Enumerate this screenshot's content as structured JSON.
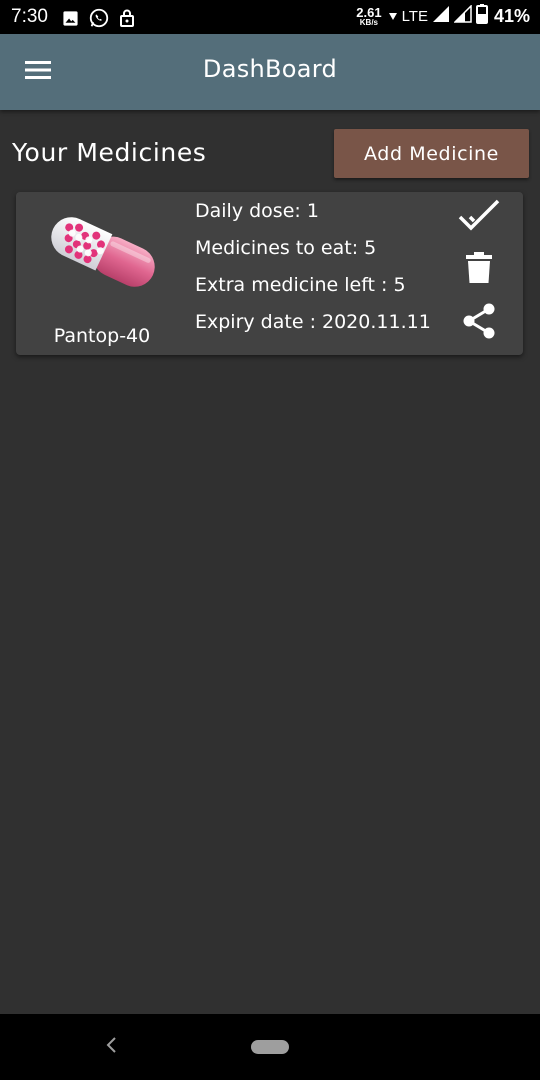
{
  "status_bar": {
    "time": "7:30",
    "network_speed": "2.61",
    "network_speed_unit": "KB/s",
    "network_type": "LTE",
    "battery": "41%",
    "icons": [
      "image-icon",
      "whatsapp-icon",
      "lock-icon",
      "data-arrow-icon",
      "signal-icon",
      "signal-icon",
      "battery-icon"
    ]
  },
  "app_bar": {
    "title": "DashBoard",
    "menu_icon": "menu-icon",
    "color": "#546e7a"
  },
  "page": {
    "section_title": "Your Medicines",
    "add_button_label": "Add Medicine",
    "add_button_color": "#795548",
    "background": "#303030"
  },
  "medicines": [
    {
      "name": "Pantop-40",
      "image": "capsule-icon",
      "daily_dose": "Daily dose: 1",
      "medicines_to_eat": "Medicines to eat: 5",
      "extra_left": "Extra medicine left : 5",
      "expiry": "Expiry date : 2020.11.11",
      "actions": [
        "double-check-icon",
        "delete-icon",
        "share-icon"
      ]
    }
  ],
  "nav_bar": {
    "back_icon": "back-icon",
    "home_icon": "home-pill-icon"
  }
}
